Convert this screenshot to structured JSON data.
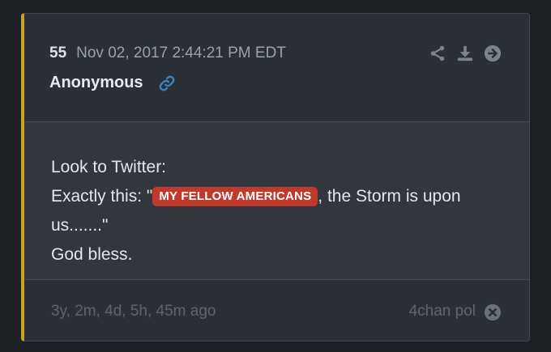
{
  "post": {
    "number": "55",
    "date": "Nov 02, 2017 2:44:21 PM EDT",
    "author": "Anonymous",
    "line1": "Look to Twitter:",
    "line2_prefix": "Exactly this: \"",
    "highlight": "MY FELLOW AMERICANS",
    "line2_suffix": ", the Storm is upon us.......\"",
    "line3": "God bless."
  },
  "footer": {
    "age": "3y, 2m, 4d, 5h, 45m ago",
    "source": "4chan pol"
  },
  "icons": {
    "link": "link-icon",
    "share": "share-icon",
    "download": "download-icon",
    "forward": "arrow-right-circle-icon",
    "close": "close-circle-icon"
  },
  "colors": {
    "accent_stripe": "#c9a227",
    "tag_background": "#c0392b",
    "link_icon": "#3b82c4"
  }
}
